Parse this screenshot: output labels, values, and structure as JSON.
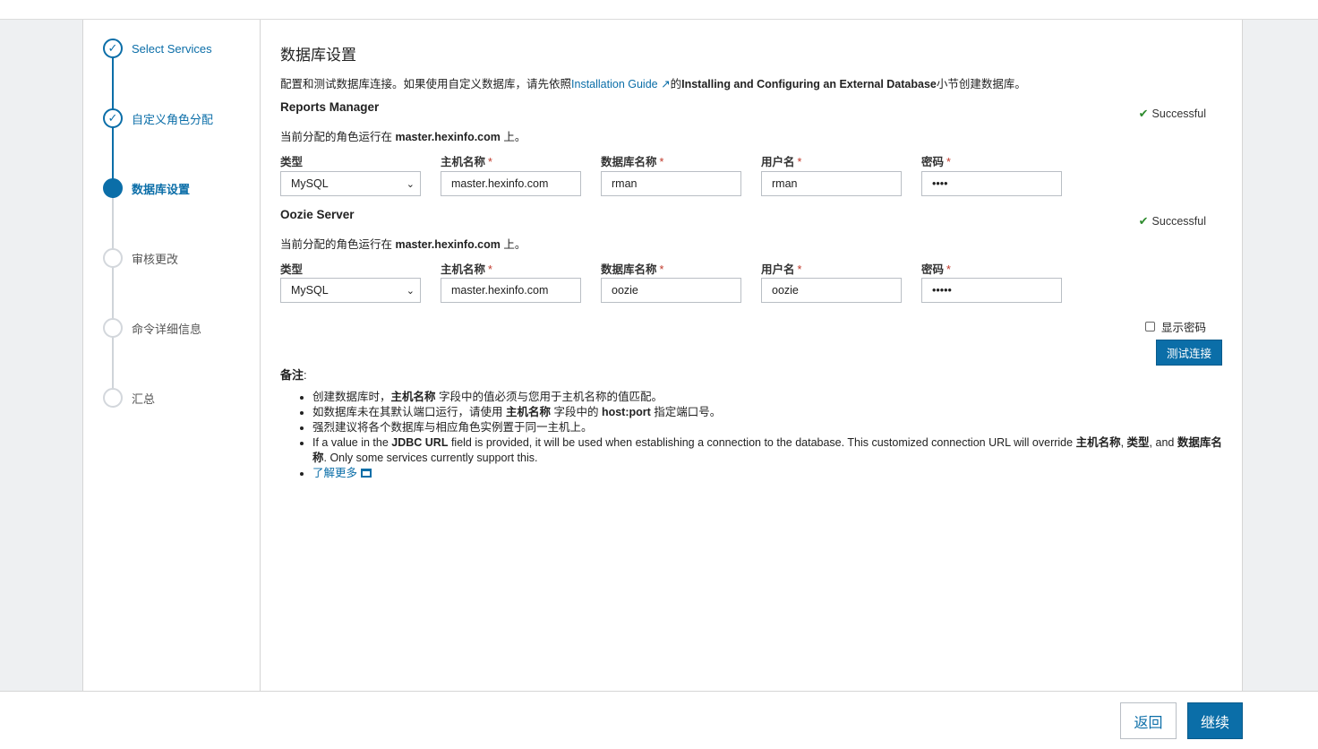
{
  "steps": [
    {
      "label": "Select Services",
      "state": "done"
    },
    {
      "label": "自定义角色分配",
      "state": "done"
    },
    {
      "label": "数据库设置",
      "state": "active"
    },
    {
      "label": "审核更改",
      "state": "todo"
    },
    {
      "label": "命令详细信息",
      "state": "todo"
    },
    {
      "label": "汇总",
      "state": "todo"
    }
  ],
  "page": {
    "title": "数据库设置",
    "intro_prefix": "配置和测试数据库连接。如果使用自定义数据库，请先依照",
    "intro_link": "Installation Guide",
    "intro_mid": "的",
    "intro_bold": "Installing and Configuring an External Database",
    "intro_suffix": "小节创建数据库。"
  },
  "labels": {
    "type": "类型",
    "host": "主机名称",
    "dbname": "数据库名称",
    "user": "用户名",
    "password": "密码",
    "required_mark": "*"
  },
  "services": [
    {
      "name": "Reports Manager",
      "status": "Successful",
      "assign_prefix": "当前分配的角色运行在 ",
      "assign_host": "master.hexinfo.com",
      "assign_suffix": " 上。",
      "type": "MySQL",
      "host": "master.hexinfo.com",
      "dbname": "rman",
      "user": "rman",
      "password": "••••"
    },
    {
      "name": "Oozie Server",
      "status": "Successful",
      "assign_prefix": "当前分配的角色运行在 ",
      "assign_host": "master.hexinfo.com",
      "assign_suffix": " 上。",
      "type": "MySQL",
      "host": "master.hexinfo.com",
      "dbname": "oozie",
      "user": "oozie",
      "password": "•••••"
    }
  ],
  "controls": {
    "show_password": "显示密码",
    "test_connection": "测试连接"
  },
  "notes": {
    "title": "备注",
    "title_colon": ":",
    "n1_a": "创建数据库时，",
    "n1_b": "主机名称",
    "n1_c": " 字段中的值必须与您用于主机名称的值匹配。",
    "n2_a": "如数据库未在其默认端口运行，请使用 ",
    "n2_b": "主机名称",
    "n2_c": " 字段中的 ",
    "n2_d": "host:port",
    "n2_e": " 指定端口号。",
    "n3": "强烈建议将各个数据库与相应角色实例置于同一主机上。",
    "n4_a": "If a value in the ",
    "n4_b": "JDBC URL",
    "n4_c": " field is provided, it will be used when establishing a connection to the database. This customized connection URL will override ",
    "n4_d": "主机名称",
    "n4_e": ", ",
    "n4_f": "类型",
    "n4_g": ", and ",
    "n4_h": "数据库名称",
    "n4_i": ". Only some services currently support this.",
    "learn_more": "了解更多"
  },
  "footer": {
    "back": "返回",
    "continue": "继续"
  }
}
